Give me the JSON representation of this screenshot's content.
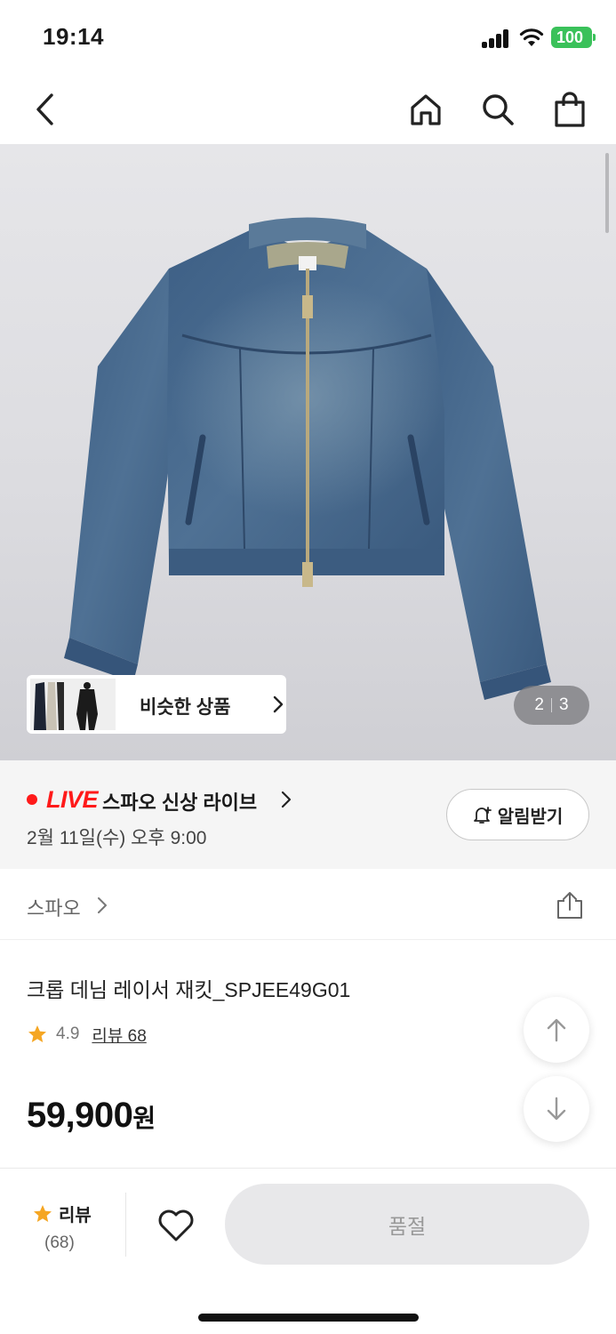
{
  "status_bar": {
    "time": "19:14",
    "battery": "100"
  },
  "header": {
    "icons": [
      "back-icon",
      "home-icon",
      "search-icon",
      "shopping-bag-icon"
    ]
  },
  "gallery": {
    "similar_label": "비슷한 상품",
    "current_page": "2",
    "total_pages": "3"
  },
  "live": {
    "badge": "LIVE",
    "title": "스파오 신상 라이브",
    "date": "2월 11일(수) 오후 9:00",
    "notify_label": "알림받기"
  },
  "brand": {
    "name": "스파오"
  },
  "product": {
    "name": "크롭 데님 레이서 재킷_SPJEE49G01",
    "rating": "4.9",
    "review_label": "리뷰 68",
    "price": "59,900",
    "price_unit": "원"
  },
  "bottom_bar": {
    "review_label": "리뷰",
    "review_count": "(68)",
    "soldout_label": "품절"
  },
  "colors": {
    "live_red": "#ff1a1a",
    "star": "#f5a623",
    "battery": "#3ac15a"
  }
}
